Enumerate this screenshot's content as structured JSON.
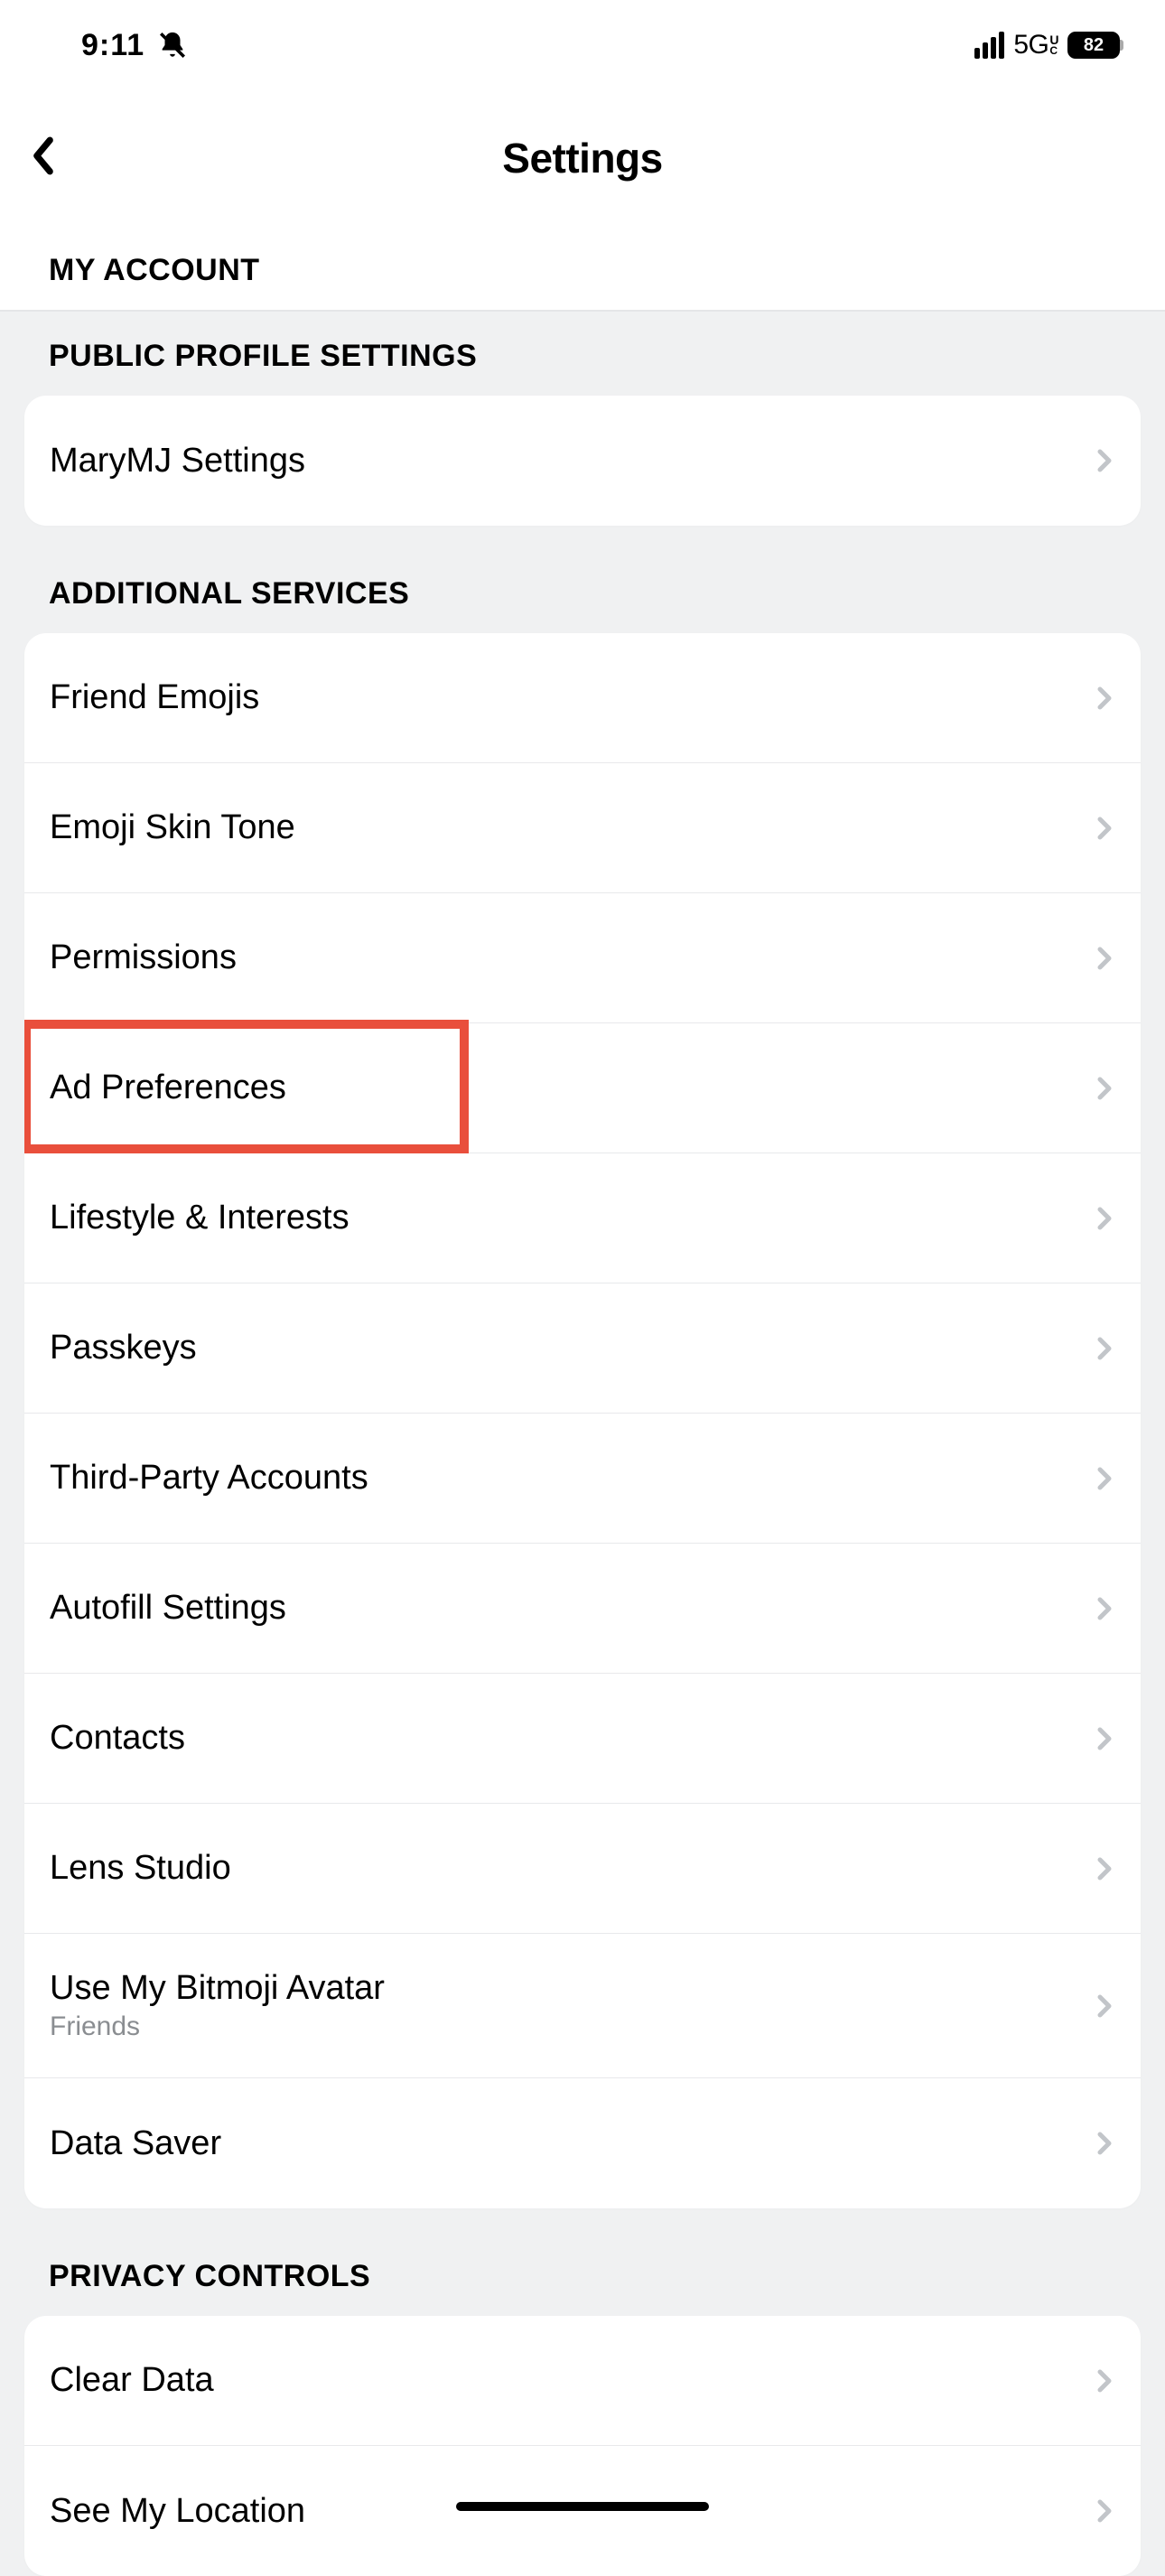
{
  "status": {
    "time": "9:11",
    "network": "5G",
    "networkSuffix": "U\nC",
    "battery": "82"
  },
  "header": {
    "title": "Settings"
  },
  "sections": [
    {
      "key": "myaccount",
      "label": "MY ACCOUNT"
    },
    {
      "key": "publicprofile",
      "label": "PUBLIC PROFILE SETTINGS"
    },
    {
      "key": "additional",
      "label": "ADDITIONAL SERVICES"
    },
    {
      "key": "privacy",
      "label": "PRIVACY CONTROLS"
    }
  ],
  "publicProfile": {
    "items": [
      {
        "label": "MaryMJ Settings"
      }
    ]
  },
  "additional": {
    "items": [
      {
        "label": "Friend Emojis"
      },
      {
        "label": "Emoji Skin Tone"
      },
      {
        "label": "Permissions"
      },
      {
        "label": "Ad Preferences"
      },
      {
        "label": "Lifestyle & Interests"
      },
      {
        "label": "Passkeys"
      },
      {
        "label": "Third-Party Accounts"
      },
      {
        "label": "Autofill Settings"
      },
      {
        "label": "Contacts"
      },
      {
        "label": "Lens Studio"
      },
      {
        "label": "Use My Bitmoji Avatar",
        "subtitle": "Friends"
      },
      {
        "label": "Data Saver"
      }
    ]
  },
  "privacy": {
    "items": [
      {
        "label": "Clear Data"
      },
      {
        "label": "See My Location"
      }
    ]
  }
}
